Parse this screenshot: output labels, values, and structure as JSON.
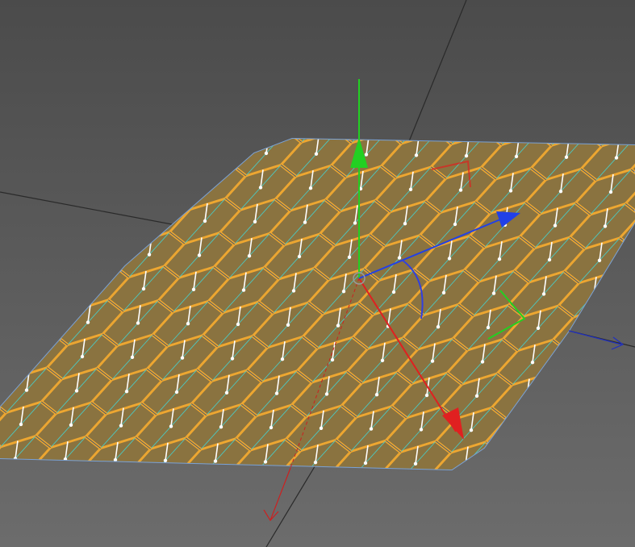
{
  "viewport": {
    "name": "3D Viewport",
    "selection_mode": "polygon",
    "normals_visible": true
  },
  "mesh": {
    "type": "hexagon-grid-plane",
    "hex_rows": 9,
    "hex_cols": 12
  },
  "gizmo": {
    "axes": [
      "x",
      "y",
      "z"
    ],
    "rotation_rings": [
      "x",
      "y",
      "z"
    ]
  },
  "colors": {
    "background_top": "#4b4b4b",
    "background_bottom": "#6c6c6c",
    "grid_line": "#2a2a2a",
    "face_fill": "#8a7340",
    "face_outline": "#f0a830",
    "edge": "#7aa2d6",
    "cyan_diag": "#4cc8c0",
    "normal": "#ffffff",
    "axis_x": "#e02020",
    "axis_y": "#22d022",
    "axis_z": "#2040e8"
  }
}
